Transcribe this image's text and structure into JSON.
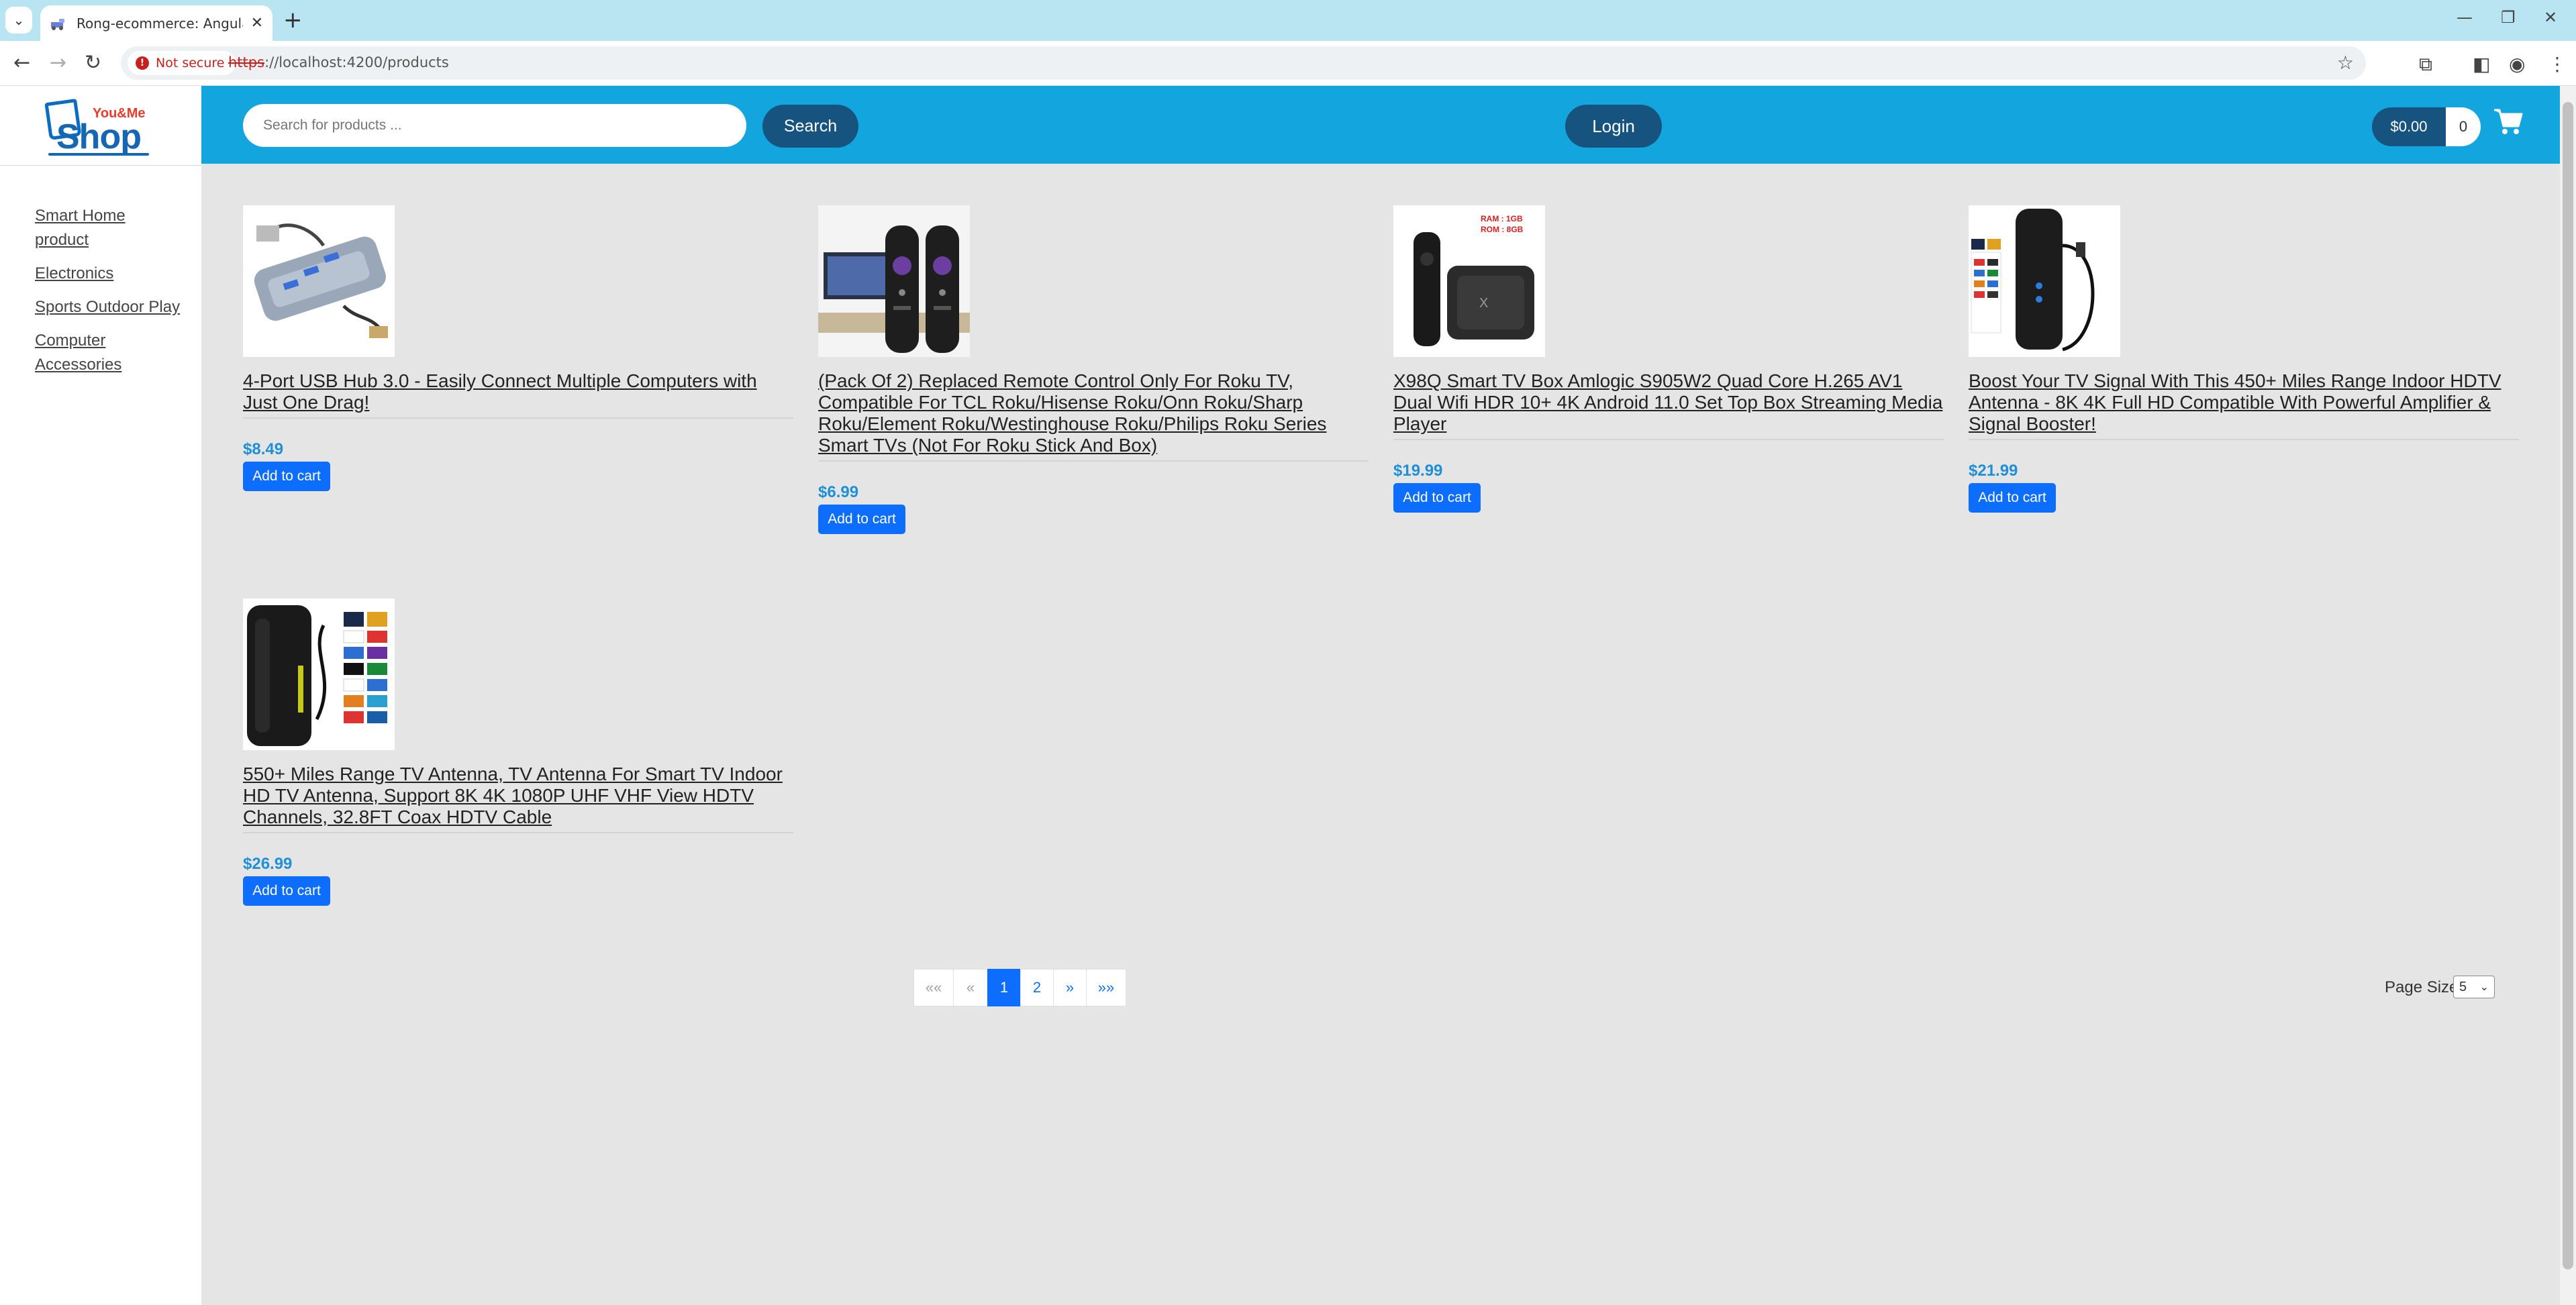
{
  "browser": {
    "tab_title": "Rong-ecommerce: Angular and",
    "not_secure_label": "Not secure",
    "url_scheme": "https",
    "url_rest": "://localhost:4200/products"
  },
  "header": {
    "search_placeholder": "Search for products ...",
    "search_label": "Search",
    "login_label": "Login",
    "cart_total": "$0.00",
    "cart_count": "0"
  },
  "logo": {
    "you_me": "You&Me",
    "shop": "Shop"
  },
  "colors": {
    "header_bg": "#13a6de",
    "dark_button": "#17537f",
    "primary": "#0d6efd",
    "price": "#1f90d6",
    "page_bg": "#e5e5e5"
  },
  "categories": [
    {
      "label": "Smart Home product"
    },
    {
      "label": "Electronics"
    },
    {
      "label": "Sports Outdoor Play"
    },
    {
      "label": "Computer Accessories"
    }
  ],
  "products": [
    {
      "title": "4-Port USB Hub 3.0 - Easily Connect Multiple Computers with Just One Drag!",
      "price": "$8.49",
      "button": "Add to cart",
      "image": "usb-hub-image"
    },
    {
      "title": "(Pack Of 2) Replaced Remote Control Only For Roku TV, Compatible For TCL Roku/Hisense Roku/Onn Roku/Sharp Roku/Element Roku/Westinghouse Roku/Philips Roku Series Smart TVs (Not For Roku Stick And Box)",
      "price": "$6.99",
      "button": "Add to cart",
      "image": "roku-remote-image"
    },
    {
      "title": "X98Q Smart TV Box Amlogic S905W2 Quad Core H.265 AV1 Dual Wifi HDR 10+ 4K Android 11.0 Set Top Box Streaming Media Player",
      "price": "$19.99",
      "button": "Add to cart",
      "image": "tv-box-image",
      "image_text": [
        "RAM : 1GB",
        "ROM : 8GB"
      ]
    },
    {
      "title": "Boost Your TV Signal With This 450+ Miles Range Indoor HDTV Antenna - 8K 4K Full HD Compatible With Powerful Amplifier & Signal Booster!",
      "price": "$21.99",
      "button": "Add to cart",
      "image": "antenna-tower-image"
    },
    {
      "title": "550+ Miles Range TV Antenna, TV Antenna For Smart TV Indoor HD TV Antenna, Support 8K 4K 1080P UHF VHF View HDTV Channels, 32.8FT Coax HDTV Cable",
      "price": "$26.99",
      "button": "Add to cart",
      "image": "antenna-panel-image"
    }
  ],
  "pagination": {
    "first": "««",
    "prev": "«",
    "pages": [
      "1",
      "2"
    ],
    "active_page": "1",
    "next": "»",
    "last": "»»",
    "page_size_label": "Page Size",
    "page_size_value": "5"
  }
}
